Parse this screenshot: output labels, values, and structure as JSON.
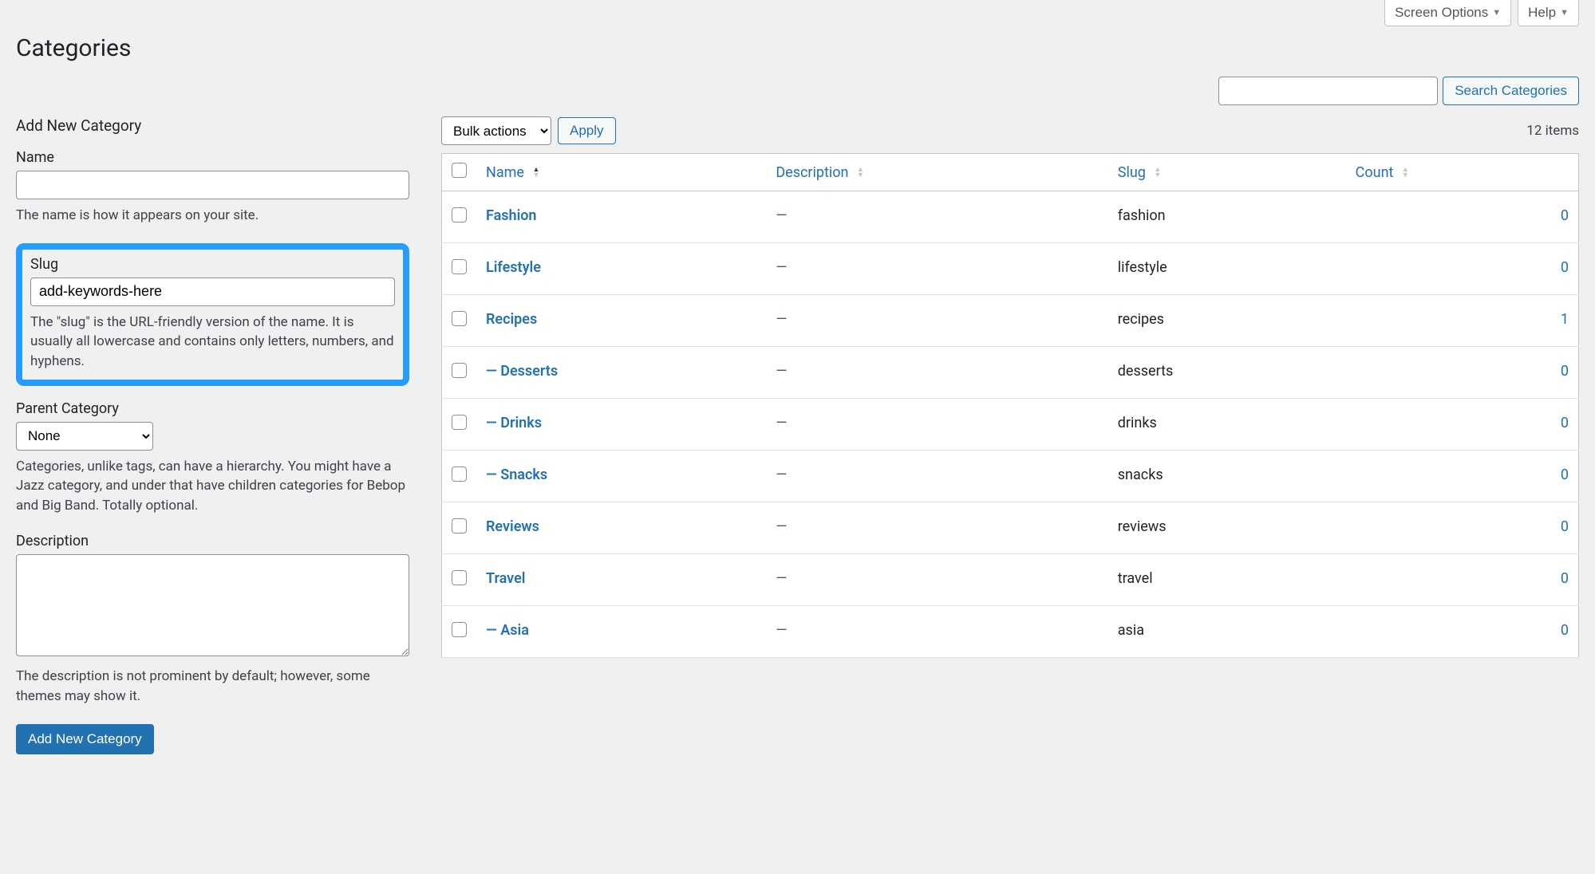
{
  "topControls": {
    "screenOptions": "Screen Options",
    "help": "Help"
  },
  "pageTitle": "Categories",
  "search": {
    "buttonLabel": "Search Categories"
  },
  "form": {
    "title": "Add New Category",
    "name": {
      "label": "Name",
      "value": "",
      "help": "The name is how it appears on your site."
    },
    "slug": {
      "label": "Slug",
      "value": "add-keywords-here",
      "help": "The \"slug\" is the URL-friendly version of the name. It is usually all lowercase and contains only letters, numbers, and hyphens."
    },
    "parent": {
      "label": "Parent Category",
      "selected": "None",
      "help": "Categories, unlike tags, can have a hierarchy. You might have a Jazz category, and under that have children categories for Bebop and Big Band. Totally optional."
    },
    "description": {
      "label": "Description",
      "value": "",
      "help": "The description is not prominent by default; however, some themes may show it."
    },
    "submitLabel": "Add New Category"
  },
  "table": {
    "bulkActionsLabel": "Bulk actions",
    "applyLabel": "Apply",
    "itemsCount": "12 items",
    "columns": {
      "name": "Name",
      "description": "Description",
      "slug": "Slug",
      "count": "Count"
    },
    "rows": [
      {
        "name": "Fashion",
        "description": "—",
        "slug": "fashion",
        "count": "0"
      },
      {
        "name": "Lifestyle",
        "description": "—",
        "slug": "lifestyle",
        "count": "0"
      },
      {
        "name": "Recipes",
        "description": "—",
        "slug": "recipes",
        "count": "1"
      },
      {
        "name": "— Desserts",
        "description": "—",
        "slug": "desserts",
        "count": "0"
      },
      {
        "name": "— Drinks",
        "description": "—",
        "slug": "drinks",
        "count": "0"
      },
      {
        "name": "— Snacks",
        "description": "—",
        "slug": "snacks",
        "count": "0"
      },
      {
        "name": "Reviews",
        "description": "—",
        "slug": "reviews",
        "count": "0"
      },
      {
        "name": "Travel",
        "description": "—",
        "slug": "travel",
        "count": "0"
      },
      {
        "name": "— Asia",
        "description": "—",
        "slug": "asia",
        "count": "0"
      }
    ]
  }
}
